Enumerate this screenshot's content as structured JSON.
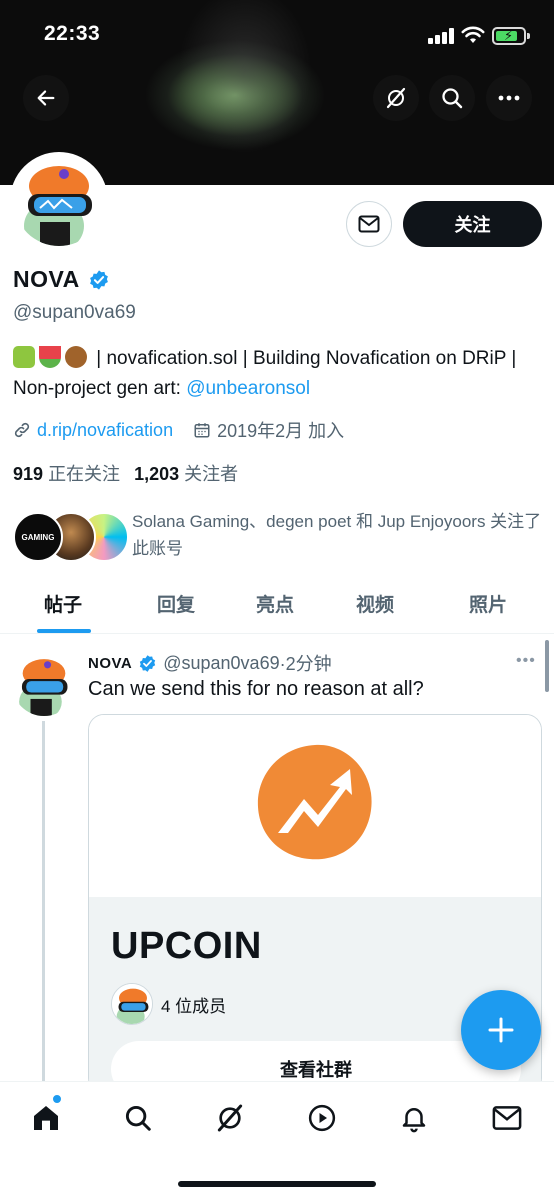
{
  "status_bar": {
    "time": "22:33"
  },
  "profile": {
    "name": "NOVA",
    "handle": "@supan0va69",
    "bio_text": " | novafication.sol | Building Novafication on DRiP | Non-project gen art: ",
    "bio_mention": "@unbearonsol",
    "website": "d.rip/novafication",
    "joined": "2019年2月 加入",
    "following_count": "919",
    "following_label": "正在关注",
    "followers_count": "1,203",
    "followers_label": "关注者",
    "followed_by": "Solana Gaming、degen poet 和 Jup Enjoyoors 关注了此账号",
    "follow_button": "关注",
    "gaming_badge": "GAMING"
  },
  "tabs": [
    {
      "label": "帖子"
    },
    {
      "label": "回复"
    },
    {
      "label": "亮点"
    },
    {
      "label": "视频"
    },
    {
      "label": "照片"
    }
  ],
  "tweet": {
    "name": "NOVA",
    "handle": "@supan0va69",
    "time": "·2分钟",
    "text": "Can we send this for no reason at all?",
    "card": {
      "title": "UPCOIN",
      "members": "4 位成员",
      "button": "查看社群"
    }
  },
  "colors": {
    "accent": "#1d9bf0",
    "upcoin_orange": "#f08a36",
    "verified": "#1d9bf0"
  },
  "icons": [
    "back-arrow-icon",
    "grok-icon",
    "search-icon",
    "more-icon",
    "mail-icon",
    "verified-badge-icon",
    "link-icon",
    "calendar-icon",
    "home-icon",
    "explore-icon",
    "grok-icon",
    "spaces-icon",
    "notifications-icon",
    "messages-icon",
    "compose-icon"
  ]
}
